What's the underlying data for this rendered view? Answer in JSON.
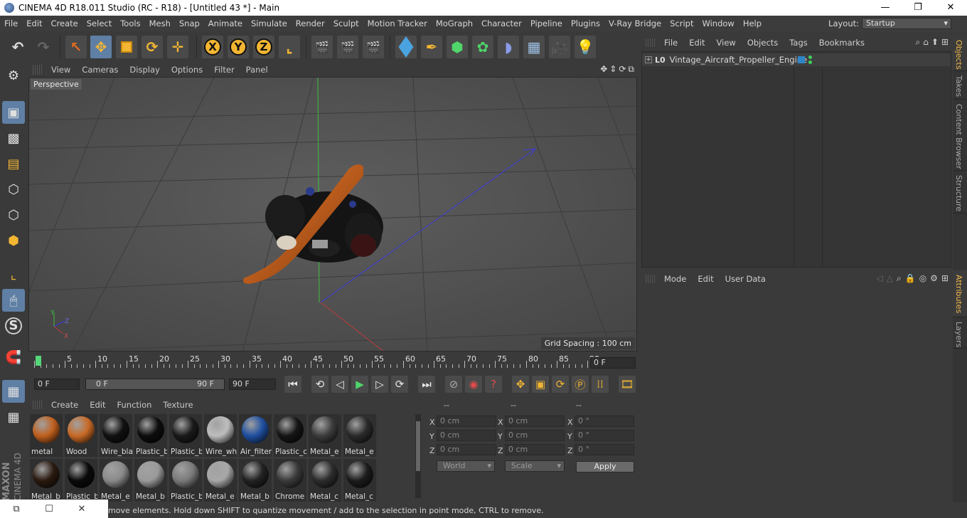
{
  "window": {
    "title": "CINEMA 4D R18.011 Studio (RC - R18) - [Untitled 43 *] - Main",
    "minimize": "—",
    "maximize": "❐",
    "close": "✕"
  },
  "menubar": {
    "items": [
      "File",
      "Edit",
      "Create",
      "Select",
      "Tools",
      "Mesh",
      "Snap",
      "Animate",
      "Simulate",
      "Render",
      "Sculpt",
      "Motion Tracker",
      "MoGraph",
      "Character",
      "Pipeline",
      "Plugins",
      "V-Ray Bridge",
      "Script",
      "Window",
      "Help"
    ],
    "layout_label": "Layout:",
    "layout_value": "Startup"
  },
  "toolbar": {
    "axis_x": "X",
    "axis_y": "Y",
    "axis_z": "Z"
  },
  "viewport": {
    "menu": [
      "View",
      "Cameras",
      "Display",
      "Options",
      "Filter",
      "Panel"
    ],
    "camera_label": "Perspective",
    "grid_spacing": "Grid Spacing : 100 cm",
    "axis_labels": {
      "y": "Y",
      "z": "Z",
      "x": "X"
    }
  },
  "timeline": {
    "ticks": [
      "0",
      "5",
      "10",
      "15",
      "20",
      "25",
      "30",
      "35",
      "40",
      "45",
      "50",
      "55",
      "60",
      "65",
      "70",
      "75",
      "80",
      "85",
      "90"
    ],
    "current_frame": "0 F"
  },
  "transport": {
    "start_field": "0 F",
    "range_start": "0 F",
    "range_end": "90 F",
    "end_field": "90 F"
  },
  "materials": {
    "menu": [
      "Create",
      "Edit",
      "Function",
      "Texture"
    ],
    "items": [
      {
        "label": "metal",
        "color": "#c0601e"
      },
      {
        "label": "Wood",
        "color": "#c96a26"
      },
      {
        "label": "Wire_bla",
        "color": "#111111"
      },
      {
        "label": "Plastic_b",
        "color": "#0d0d0d"
      },
      {
        "label": "Plastic_b",
        "color": "#1a1a1a"
      },
      {
        "label": "Wire_wh",
        "color": "#bdbdbd"
      },
      {
        "label": "Air_filter",
        "color": "#1f4fa0"
      },
      {
        "label": "Plastic_c",
        "color": "#151515"
      },
      {
        "label": "Metal_e",
        "color": "#3c3c3c"
      },
      {
        "label": "Metal_e",
        "color": "#2a2a2a"
      },
      {
        "label": "Metal_b",
        "color": "#2a1a10"
      },
      {
        "label": "Plastic_b",
        "color": "#0a0a0a"
      },
      {
        "label": "Metal_e",
        "color": "#8a8a8a"
      },
      {
        "label": "Metal_b",
        "color": "#9a9a9a"
      },
      {
        "label": "Plastic_b",
        "color": "#7a7a7a"
      },
      {
        "label": "Metal_e",
        "color": "#a8a8a8"
      },
      {
        "label": "Metal_b",
        "color": "#222222"
      },
      {
        "label": "Chrome",
        "color": "#3a3a3a"
      },
      {
        "label": "Metal_c",
        "color": "#2c2c2c"
      },
      {
        "label": "Metal_c",
        "color": "#1c1c1c"
      }
    ]
  },
  "coordinates": {
    "headers": [
      "--",
      "--",
      "--"
    ],
    "rows": [
      {
        "a": "X",
        "pos": "0 cm",
        "b": "X",
        "size": "0 cm",
        "c": "X",
        "rot": "0 °"
      },
      {
        "a": "Y",
        "pos": "0 cm",
        "b": "Y",
        "size": "0 cm",
        "c": "Y",
        "rot": "0 °"
      },
      {
        "a": "Z",
        "pos": "0 cm",
        "b": "Z",
        "size": "0 cm",
        "c": "Z",
        "rot": "0 °"
      }
    ],
    "mode_select": "World",
    "type_select": "Scale",
    "apply": "Apply"
  },
  "objects": {
    "menu": [
      "File",
      "Edit",
      "View",
      "Objects",
      "Tags",
      "Bookmarks"
    ],
    "items": [
      {
        "name": "Vintage_Aircraft_Propeller_Engine",
        "type": "L0"
      }
    ]
  },
  "attributes": {
    "menu": [
      "Mode",
      "Edit",
      "User Data"
    ]
  },
  "side_tabs": [
    "Objects",
    "Takes",
    "Content Browser",
    "Structure",
    "Attributes",
    "Layers"
  ],
  "status": {
    "text": "move elements. Hold down SHIFT to quantize movement / add to the selection in point mode, CTRL to remove."
  },
  "branding": {
    "maxon": "MAXON",
    "cinema": "CINEMA 4D"
  }
}
